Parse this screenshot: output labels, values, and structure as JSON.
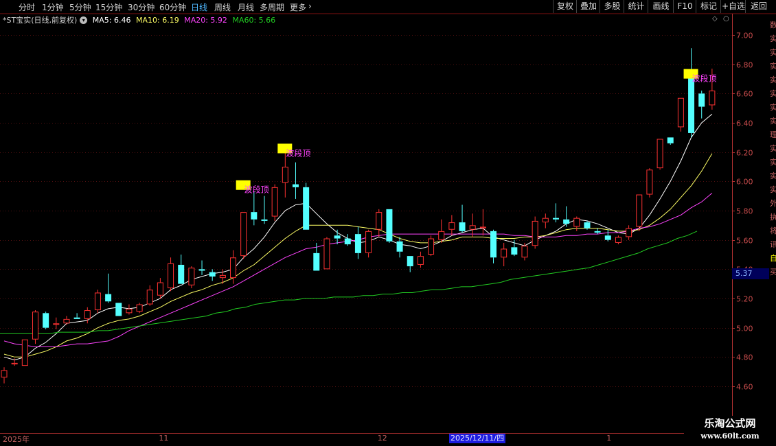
{
  "toolbar": {
    "timeframes": [
      {
        "label": "分时",
        "active": false
      },
      {
        "label": "1分钟",
        "active": false
      },
      {
        "label": "5分钟",
        "active": false
      },
      {
        "label": "15分钟",
        "active": false
      },
      {
        "label": "30分钟",
        "active": false
      },
      {
        "label": "60分钟",
        "active": false
      },
      {
        "label": "日线",
        "active": true
      },
      {
        "label": "周线",
        "active": false
      },
      {
        "label": "月线",
        "active": false
      },
      {
        "label": "多周期",
        "active": false
      },
      {
        "label": "更多",
        "active": false
      }
    ],
    "more_arrow": "chevron-right-icon",
    "right_buttons": [
      "复权",
      "叠加",
      "多股",
      "统计",
      "画线",
      "F10",
      "标记",
      "+自选",
      "返回"
    ]
  },
  "legend": {
    "title": "*ST宝实(日线,前复权)",
    "ma5": "MA5: 6.46",
    "ma10": "MA10: 6.19",
    "ma20": "MA20: 5.92",
    "ma60": "MA60: 5.66"
  },
  "colors": {
    "up": "#ff3232",
    "down": "#54ffff",
    "ma5": "#ffffff",
    "ma10": "#ffff66",
    "ma20": "#ff44ff",
    "ma60": "#22cc22",
    "annotation_bg": "#ffff00",
    "annotation_text": "#ff44ff",
    "axis": "#b03030",
    "grid": "#501010"
  },
  "current_price_label": "5.37",
  "date_cursor": "2025/12/11/四",
  "right_panel_chars": [
    "数",
    "实",
    "实",
    "实",
    "实",
    "实",
    "实",
    "实",
    "理",
    "实",
    "实",
    "实",
    "实",
    "外",
    "执",
    "将",
    "讯",
    "自",
    "买"
  ],
  "watermark": {
    "title": "乐淘公式网",
    "url": "www.60lt.com"
  },
  "chart_data": {
    "type": "candlestick",
    "title": "*ST宝实(日线,前复权)",
    "ylim": [
      4.6,
      7.0
    ],
    "y_ticks": [
      4.6,
      4.8,
      5.0,
      5.2,
      5.4,
      5.6,
      5.8,
      6.0,
      6.2,
      6.4,
      6.6,
      6.8,
      7.0
    ],
    "x_tick_labels": [
      {
        "label": "2025年",
        "index": 0
      },
      {
        "label": "11",
        "index": 15
      },
      {
        "label": "12",
        "index": 36
      },
      {
        "label": "1",
        "index": 58
      }
    ],
    "candles": [
      {
        "o": 4.66,
        "h": 4.73,
        "l": 4.62,
        "c": 4.71
      },
      {
        "o": 4.75,
        "h": 4.79,
        "l": 4.74,
        "c": 4.76
      },
      {
        "o": 4.74,
        "h": 4.91,
        "l": 4.74,
        "c": 4.92
      },
      {
        "o": 4.92,
        "h": 5.12,
        "l": 4.89,
        "c": 5.11
      },
      {
        "o": 5.1,
        "h": 5.11,
        "l": 4.99,
        "c": 5.0
      },
      {
        "o": 5.02,
        "h": 5.07,
        "l": 4.99,
        "c": 5.03
      },
      {
        "o": 5.03,
        "h": 5.08,
        "l": 5.02,
        "c": 5.06
      },
      {
        "o": 5.07,
        "h": 5.1,
        "l": 5.06,
        "c": 5.06
      },
      {
        "o": 5.06,
        "h": 5.14,
        "l": 5.03,
        "c": 5.12
      },
      {
        "o": 5.12,
        "h": 5.26,
        "l": 5.1,
        "c": 5.24
      },
      {
        "o": 5.23,
        "h": 5.37,
        "l": 5.17,
        "c": 5.18
      },
      {
        "o": 5.17,
        "h": 5.15,
        "l": 5.09,
        "c": 5.08
      },
      {
        "o": 5.1,
        "h": 5.16,
        "l": 5.09,
        "c": 5.13
      },
      {
        "o": 5.11,
        "h": 5.17,
        "l": 5.1,
        "c": 5.16
      },
      {
        "o": 5.16,
        "h": 5.29,
        "l": 5.15,
        "c": 5.26
      },
      {
        "o": 5.22,
        "h": 5.34,
        "l": 5.2,
        "c": 5.31
      },
      {
        "o": 5.27,
        "h": 5.48,
        "l": 5.25,
        "c": 5.44
      },
      {
        "o": 5.43,
        "h": 5.5,
        "l": 5.31,
        "c": 5.3
      },
      {
        "o": 5.29,
        "h": 5.42,
        "l": 5.27,
        "c": 5.41
      },
      {
        "o": 5.4,
        "h": 5.46,
        "l": 5.36,
        "c": 5.39
      },
      {
        "o": 5.38,
        "h": 5.4,
        "l": 5.32,
        "c": 5.35
      },
      {
        "o": 5.34,
        "h": 5.4,
        "l": 5.3,
        "c": 5.36
      },
      {
        "o": 5.34,
        "h": 5.53,
        "l": 5.3,
        "c": 5.48
      },
      {
        "o": 5.49,
        "h": 5.71,
        "l": 5.47,
        "c": 5.79
      },
      {
        "o": 5.79,
        "h": 5.93,
        "l": 5.7,
        "c": 5.74
      },
      {
        "o": 5.74,
        "h": 5.9,
        "l": 5.71,
        "c": 5.73
      },
      {
        "o": 5.76,
        "h": 5.98,
        "l": 5.73,
        "c": 5.96
      },
      {
        "o": 5.99,
        "h": 6.23,
        "l": 5.89,
        "c": 6.1
      },
      {
        "o": 5.98,
        "h": 6.13,
        "l": 5.88,
        "c": 5.96
      },
      {
        "o": 5.96,
        "h": 5.99,
        "l": 5.67,
        "c": 5.67
      },
      {
        "o": 5.51,
        "h": 5.58,
        "l": 5.39,
        "c": 5.39
      },
      {
        "o": 5.4,
        "h": 5.62,
        "l": 5.4,
        "c": 5.61
      },
      {
        "o": 5.63,
        "h": 5.67,
        "l": 5.57,
        "c": 5.61
      },
      {
        "o": 5.61,
        "h": 5.64,
        "l": 5.56,
        "c": 5.57
      },
      {
        "o": 5.64,
        "h": 5.69,
        "l": 5.47,
        "c": 5.51
      },
      {
        "o": 5.51,
        "h": 5.67,
        "l": 5.48,
        "c": 5.66
      },
      {
        "o": 5.67,
        "h": 5.81,
        "l": 5.62,
        "c": 5.79
      },
      {
        "o": 5.81,
        "h": 5.8,
        "l": 5.58,
        "c": 5.59
      },
      {
        "o": 5.59,
        "h": 5.62,
        "l": 5.48,
        "c": 5.52
      },
      {
        "o": 5.49,
        "h": 5.48,
        "l": 5.38,
        "c": 5.42
      },
      {
        "o": 5.43,
        "h": 5.52,
        "l": 5.41,
        "c": 5.49
      },
      {
        "o": 5.5,
        "h": 5.63,
        "l": 5.49,
        "c": 5.61
      },
      {
        "o": 5.6,
        "h": 5.74,
        "l": 5.58,
        "c": 5.66
      },
      {
        "o": 5.67,
        "h": 5.77,
        "l": 5.63,
        "c": 5.72
      },
      {
        "o": 5.72,
        "h": 5.84,
        "l": 5.65,
        "c": 5.66
      },
      {
        "o": 5.67,
        "h": 5.78,
        "l": 5.62,
        "c": 5.7
      },
      {
        "o": 5.68,
        "h": 5.81,
        "l": 5.63,
        "c": 5.69
      },
      {
        "o": 5.66,
        "h": 5.67,
        "l": 5.44,
        "c": 5.48
      },
      {
        "o": 5.48,
        "h": 5.58,
        "l": 5.42,
        "c": 5.54
      },
      {
        "o": 5.55,
        "h": 5.6,
        "l": 5.49,
        "c": 5.5
      },
      {
        "o": 5.48,
        "h": 5.58,
        "l": 5.46,
        "c": 5.56
      },
      {
        "o": 5.56,
        "h": 5.76,
        "l": 5.54,
        "c": 5.73
      },
      {
        "o": 5.72,
        "h": 5.78,
        "l": 5.68,
        "c": 5.75
      },
      {
        "o": 5.75,
        "h": 5.85,
        "l": 5.72,
        "c": 5.74
      },
      {
        "o": 5.74,
        "h": 5.83,
        "l": 5.69,
        "c": 5.71
      },
      {
        "o": 5.69,
        "h": 5.76,
        "l": 5.66,
        "c": 5.75
      },
      {
        "o": 5.72,
        "h": 5.73,
        "l": 5.67,
        "c": 5.68
      },
      {
        "o": 5.66,
        "h": 5.68,
        "l": 5.64,
        "c": 5.65
      },
      {
        "o": 5.63,
        "h": 5.67,
        "l": 5.59,
        "c": 5.6
      },
      {
        "o": 5.58,
        "h": 5.63,
        "l": 5.57,
        "c": 5.62
      },
      {
        "o": 5.62,
        "h": 5.7,
        "l": 5.6,
        "c": 5.68
      },
      {
        "o": 5.69,
        "h": 5.91,
        "l": 5.66,
        "c": 5.91
      },
      {
        "o": 5.91,
        "h": 6.09,
        "l": 5.89,
        "c": 6.08
      },
      {
        "o": 6.09,
        "h": 6.29,
        "l": 6.08,
        "c": 6.29
      },
      {
        "o": 6.3,
        "h": 6.27,
        "l": 6.25,
        "c": 6.26
      },
      {
        "o": 6.37,
        "h": 6.52,
        "l": 6.34,
        "c": 6.57
      },
      {
        "o": 6.74,
        "h": 6.91,
        "l": 6.3,
        "c": 6.33
      },
      {
        "o": 6.6,
        "h": 6.62,
        "l": 6.43,
        "c": 6.51
      },
      {
        "o": 6.52,
        "h": 6.77,
        "l": 6.49,
        "c": 6.62
      }
    ],
    "series": [
      {
        "name": "MA5",
        "values": [
          4.8,
          4.78,
          4.8,
          4.86,
          4.9,
          4.96,
          5.03,
          5.04,
          5.05,
          5.1,
          5.13,
          5.14,
          5.13,
          5.14,
          5.17,
          5.2,
          5.26,
          5.29,
          5.33,
          5.35,
          5.37,
          5.38,
          5.4,
          5.48,
          5.54,
          5.62,
          5.72,
          5.8,
          5.84,
          5.85,
          5.78,
          5.71,
          5.65,
          5.61,
          5.58,
          5.59,
          5.62,
          5.6,
          5.57,
          5.56,
          5.54,
          5.56,
          5.59,
          5.63,
          5.65,
          5.67,
          5.68,
          5.62,
          5.6,
          5.58,
          5.56,
          5.6,
          5.63,
          5.66,
          5.71,
          5.74,
          5.73,
          5.71,
          5.68,
          5.65,
          5.64,
          5.68,
          5.77,
          5.88,
          6.0,
          6.14,
          6.3,
          6.4,
          6.46
        ]
      },
      {
        "name": "MA10",
        "values": [
          4.82,
          4.8,
          4.8,
          4.82,
          4.84,
          4.87,
          4.91,
          4.93,
          4.96,
          5.0,
          5.03,
          5.05,
          5.06,
          5.08,
          5.11,
          5.14,
          5.18,
          5.21,
          5.24,
          5.26,
          5.29,
          5.31,
          5.34,
          5.39,
          5.43,
          5.49,
          5.55,
          5.61,
          5.66,
          5.7,
          5.7,
          5.7,
          5.7,
          5.7,
          5.69,
          5.68,
          5.67,
          5.64,
          5.61,
          5.59,
          5.58,
          5.58,
          5.59,
          5.6,
          5.62,
          5.62,
          5.62,
          5.61,
          5.61,
          5.61,
          5.62,
          5.62,
          5.63,
          5.65,
          5.67,
          5.68,
          5.68,
          5.68,
          5.67,
          5.66,
          5.66,
          5.67,
          5.7,
          5.75,
          5.81,
          5.89,
          5.97,
          6.07,
          6.19
        ]
      },
      {
        "name": "MA20",
        "values": [
          4.91,
          4.89,
          4.88,
          4.87,
          4.87,
          4.87,
          4.88,
          4.89,
          4.89,
          4.9,
          4.91,
          4.94,
          4.98,
          5.01,
          5.04,
          5.07,
          5.1,
          5.13,
          5.16,
          5.19,
          5.22,
          5.25,
          5.28,
          5.32,
          5.36,
          5.4,
          5.44,
          5.48,
          5.51,
          5.54,
          5.55,
          5.57,
          5.58,
          5.59,
          5.6,
          5.62,
          5.63,
          5.64,
          5.64,
          5.64,
          5.64,
          5.64,
          5.64,
          5.64,
          5.64,
          5.64,
          5.64,
          5.64,
          5.64,
          5.63,
          5.63,
          5.62,
          5.62,
          5.62,
          5.63,
          5.63,
          5.64,
          5.64,
          5.65,
          5.65,
          5.66,
          5.68,
          5.69,
          5.71,
          5.74,
          5.77,
          5.82,
          5.86,
          5.92
        ]
      },
      {
        "name": "MA60",
        "values": [
          4.96,
          4.96,
          4.96,
          4.96,
          4.96,
          4.96,
          4.97,
          4.97,
          4.97,
          4.97,
          4.98,
          4.98,
          4.99,
          5.0,
          5.01,
          5.02,
          5.03,
          5.04,
          5.05,
          5.06,
          5.07,
          5.08,
          5.1,
          5.11,
          5.13,
          5.14,
          5.16,
          5.17,
          5.18,
          5.19,
          5.19,
          5.2,
          5.2,
          5.2,
          5.21,
          5.21,
          5.21,
          5.22,
          5.22,
          5.23,
          5.23,
          5.24,
          5.24,
          5.25,
          5.26,
          5.26,
          5.27,
          5.28,
          5.28,
          5.29,
          5.3,
          5.31,
          5.33,
          5.34,
          5.35,
          5.36,
          5.37,
          5.38,
          5.39,
          5.4,
          5.41,
          5.43,
          5.45,
          5.47,
          5.49,
          5.51,
          5.54,
          5.56,
          5.58,
          5.61,
          5.63,
          5.66
        ]
      }
    ],
    "annotations": [
      {
        "text": "波段顶",
        "index": 23,
        "price": 5.97
      },
      {
        "text": "波段顶",
        "index": 27,
        "price": 6.22
      },
      {
        "text": "波段顶",
        "index": 66,
        "price": 6.73
      }
    ],
    "grid": true,
    "legend_position": "top-left"
  }
}
